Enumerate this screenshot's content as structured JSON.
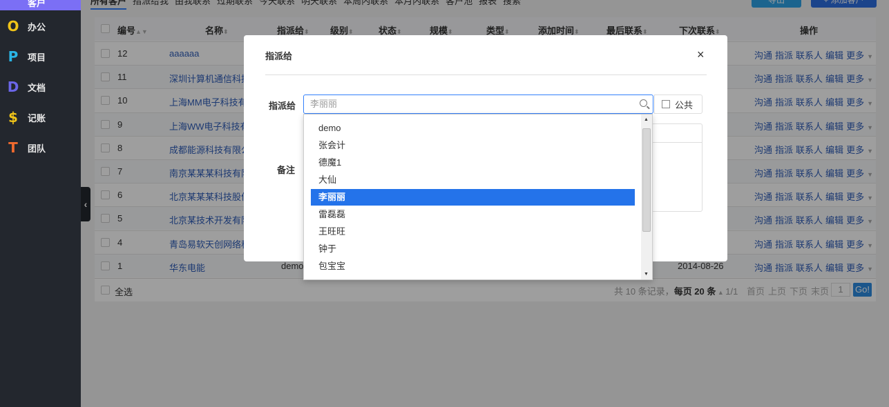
{
  "sidebar": {
    "top_label": "客户",
    "items": [
      {
        "icon": "O",
        "label": "办公",
        "color": "#f0c419"
      },
      {
        "icon": "P",
        "label": "项目",
        "color": "#2ab5e6"
      },
      {
        "icon": "D",
        "label": "文档",
        "color": "#6b66e8"
      },
      {
        "icon": "$",
        "label": "记账",
        "color": "#f0c419"
      },
      {
        "icon": "T",
        "label": "团队",
        "color": "#f06a2e"
      }
    ]
  },
  "tabs": [
    "所有客户",
    "指派给我",
    "由我联系",
    "过期联系",
    "今天联系",
    "明天联系",
    "本周内联系",
    "本月内联系",
    "客户池",
    "报表",
    "搜索"
  ],
  "toolbar": {
    "export": "导出",
    "add": "+ 添加客户"
  },
  "table": {
    "headers": [
      "编号",
      "名称",
      "指派给",
      "级别",
      "状态",
      "规模",
      "类型",
      "添加时间",
      "最后联系",
      "下次联系",
      "操作"
    ],
    "rows": [
      {
        "id": "12",
        "name": "aaaaaa",
        "assigned": "",
        "next": ""
      },
      {
        "id": "11",
        "name": "深圳计算机通信科技",
        "assigned": "",
        "next": ""
      },
      {
        "id": "10",
        "name": "上海MM电子科技有",
        "assigned": "",
        "next": ""
      },
      {
        "id": "9",
        "name": "上海WW电子科技有",
        "assigned": "",
        "next": ""
      },
      {
        "id": "8",
        "name": "成都能源科技有限公",
        "assigned": "",
        "next": ""
      },
      {
        "id": "7",
        "name": "南京某某某科技有限",
        "assigned": "",
        "next": ""
      },
      {
        "id": "6",
        "name": "北京某某某科技股份",
        "assigned": "",
        "next": ""
      },
      {
        "id": "5",
        "name": "北京某技术开发有限",
        "assigned": "",
        "next": ""
      },
      {
        "id": "4",
        "name": "青岛易软天创网络科",
        "assigned": "",
        "next": ""
      },
      {
        "id": "1",
        "name": "华东电能",
        "assigned": "demo",
        "next": "2014-08-26"
      }
    ],
    "actions": [
      "沟通",
      "指派",
      "联系人",
      "编辑",
      "更多"
    ],
    "select_all": "全选",
    "pager": {
      "summary": "共 10 条记录，",
      "per_page": "每页 20 条",
      "page": "1/1",
      "first": "首页",
      "prev": "上页",
      "next": "下页",
      "last": "末页",
      "page_input": "1",
      "go": "Go!"
    }
  },
  "modal": {
    "title": "指派给",
    "close": "×",
    "assign_label": "指派给",
    "assign_value": "李丽丽",
    "public_label": "公共",
    "note_label": "备注",
    "options": [
      "demo",
      "张会计",
      "德魔1",
      "大仙",
      "李丽丽",
      "雷磊磊",
      "王旺旺",
      "钟于",
      "包宝宝"
    ],
    "selected_index": 4
  }
}
